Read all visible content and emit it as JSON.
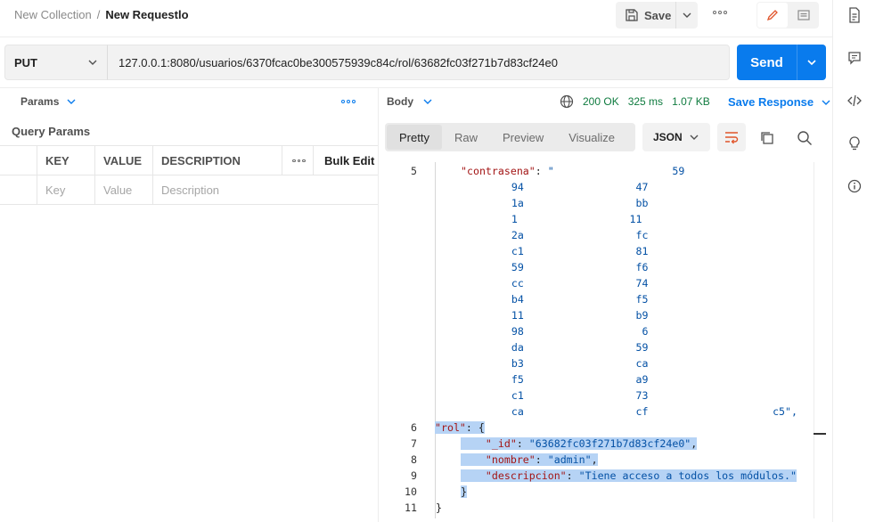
{
  "breadcrumb": {
    "collection": "New Collection",
    "separator": "/",
    "request": "New Requestlo"
  },
  "toolbar": {
    "save_label": "Save"
  },
  "request": {
    "method": "PUT",
    "url": "127.0.0.1:8080/usuarios/6370fcac0be300575939c84c/rol/63682fc03f271b7d83cf24e0",
    "send_label": "Send"
  },
  "params": {
    "tab_label": "Params",
    "section_title": "Query Params",
    "columns": [
      "KEY",
      "VALUE",
      "DESCRIPTION"
    ],
    "bulk_edit": "Bulk Edit",
    "placeholders": {
      "key": "Key",
      "value": "Value",
      "description": "Description"
    }
  },
  "response": {
    "tab_label": "Body",
    "status": "200 OK",
    "time": "325 ms",
    "size": "1.07 KB",
    "save_response": "Save Response",
    "views": [
      "Pretty",
      "Raw",
      "Preview",
      "Visualize"
    ],
    "active_view": "Pretty",
    "format": "JSON",
    "lines": [
      {
        "no": "5",
        "parts": [
          {
            "t": "\"contrasena\"",
            "c": "key"
          },
          {
            "t": ": ",
            "c": "pun"
          },
          {
            "t": "\"",
            "c": "str"
          },
          {
            "t": "                   59",
            "c": "str"
          }
        ]
      },
      {
        "no": "",
        "parts": [
          {
            "t": "    94                  47",
            "c": "str"
          }
        ]
      },
      {
        "no": "",
        "parts": [
          {
            "t": "    1a                  bb",
            "c": "str"
          }
        ]
      },
      {
        "no": "",
        "parts": [
          {
            "t": "    1                  11",
            "c": "str"
          }
        ]
      },
      {
        "no": "",
        "parts": [
          {
            "t": "    2a                  fc",
            "c": "str"
          }
        ]
      },
      {
        "no": "",
        "parts": [
          {
            "t": "    c1                  81",
            "c": "str"
          }
        ]
      },
      {
        "no": "",
        "parts": [
          {
            "t": "    59                  f6",
            "c": "str"
          }
        ]
      },
      {
        "no": "",
        "parts": [
          {
            "t": "    cc                  74",
            "c": "str"
          }
        ]
      },
      {
        "no": "",
        "parts": [
          {
            "t": "    b4                  f5",
            "c": "str"
          }
        ]
      },
      {
        "no": "",
        "parts": [
          {
            "t": "    11                  b9",
            "c": "str"
          }
        ]
      },
      {
        "no": "",
        "parts": [
          {
            "t": "    98                   6",
            "c": "str"
          }
        ]
      },
      {
        "no": "",
        "parts": [
          {
            "t": "    da                  59",
            "c": "str"
          }
        ]
      },
      {
        "no": "",
        "parts": [
          {
            "t": "    b3                  ca",
            "c": "str"
          }
        ]
      },
      {
        "no": "",
        "parts": [
          {
            "t": "    f5                  a9",
            "c": "str"
          }
        ]
      },
      {
        "no": "",
        "parts": [
          {
            "t": "    c1                  73",
            "c": "str"
          }
        ]
      },
      {
        "no": "",
        "parts": [
          {
            "t": "    ca                  cf                    c5\",",
            "c": "str"
          }
        ]
      },
      {
        "no": "6",
        "parts": [
          {
            "t": "\"rol\"",
            "c": "key"
          },
          {
            "t": ": {",
            "c": "pun"
          }
        ]
      },
      {
        "no": "7",
        "parts": [
          {
            "t": "    ",
            "c": "pun"
          },
          {
            "t": "\"_id\"",
            "c": "key"
          },
          {
            "t": ": ",
            "c": "pun"
          },
          {
            "t": "\"63682fc03f271b7d83cf24e0\"",
            "c": "str"
          },
          {
            "t": ",",
            "c": "pun"
          }
        ]
      },
      {
        "no": "8",
        "parts": [
          {
            "t": "    ",
            "c": "pun"
          },
          {
            "t": "\"nombre\"",
            "c": "key"
          },
          {
            "t": ": ",
            "c": "pun"
          },
          {
            "t": "\"admin\"",
            "c": "str"
          },
          {
            "t": ",",
            "c": "pun"
          }
        ]
      },
      {
        "no": "9",
        "parts": [
          {
            "t": "    ",
            "c": "pun"
          },
          {
            "t": "\"descripcion\"",
            "c": "key"
          },
          {
            "t": ": ",
            "c": "pun"
          },
          {
            "t": "\"Tiene acceso a todos los módulos.\"",
            "c": "str"
          }
        ]
      },
      {
        "no": "10",
        "parts": [
          {
            "t": "}",
            "c": "pun"
          }
        ]
      },
      {
        "no": "11",
        "parts": [
          {
            "t": "}",
            "c": "pun"
          }
        ]
      }
    ]
  },
  "colors": {
    "accent": "#097bed",
    "status_ok": "#0f7b3f",
    "selection": "#b6d3f5"
  }
}
